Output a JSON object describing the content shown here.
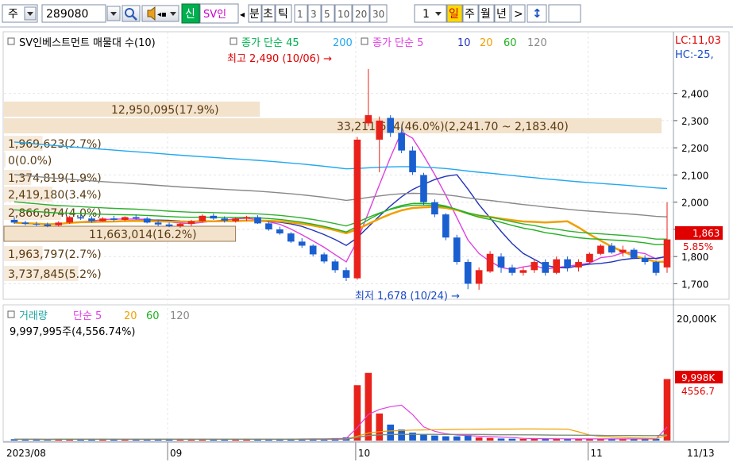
{
  "toolbar": {
    "market_label": "주",
    "code_value": "289080",
    "badge_new": "신",
    "name_value": "SV인",
    "period_btn_tick": "틱",
    "period_btn_min": "분",
    "period_btn_sec": "초",
    "intervals": [
      "1",
      "3",
      "5",
      "10",
      "20",
      "30"
    ],
    "interval_value": "1",
    "period_day": "일",
    "period_week": "주",
    "period_month": "월",
    "period_year": "년",
    "nav_prev": "◂",
    "nav_next": ">",
    "updown_icon": "↕",
    "colors": {
      "highlight": "#ffd800",
      "badge_green": "#00b050"
    }
  },
  "price_panel": {
    "legend": {
      "title": "SV인베스트먼트 매물대 수(10)",
      "ma_long_label": "종가 단순 45",
      "ma_long_200": "200",
      "ma_short_label": "종가 단순 5",
      "ma_short_10": "10",
      "ma_short_20": "20",
      "ma_short_60": "60",
      "ma_short_120": "120"
    },
    "corner_lc": "LC:11,03",
    "corner_hc": "HC:-25,",
    "last_price_tag": "1,863",
    "last_change_tag": "5.85%",
    "high_annot": "최고 2,490 (10/06) →",
    "low_annot": "최저 1,678 (10/24) →",
    "volume_profile": [
      {
        "label": "12,950,095(17.9%)",
        "pct": 17.9
      },
      {
        "label": "33,211,664(46.0%)(2,241.70 ~ 2,183.40)",
        "pct": 46.0
      },
      {
        "label": "1,969,623(2.7%)",
        "pct": 2.7
      },
      {
        "label": "0(0.0%)",
        "pct": 0.0
      },
      {
        "label": "1,374,819(1.9%)",
        "pct": 1.9
      },
      {
        "label": "2,419,180(3.4%)",
        "pct": 3.4
      },
      {
        "label": "2,866,874(4.0%)",
        "pct": 4.0
      },
      {
        "label": "11,663,014(16.2%)",
        "pct": 16.2
      },
      {
        "label": "1,963,797(2.7%)",
        "pct": 2.7
      },
      {
        "label": "3,737,845(5.2%)",
        "pct": 5.2
      }
    ]
  },
  "volume_panel": {
    "legend": {
      "title": "거래량",
      "ma_label": "단순 5",
      "ma_20": "20",
      "ma_60": "60",
      "ma_120": "120"
    },
    "summary": "9,997,995주(4,556.74%)",
    "last_volume_tag": "9,998K",
    "ma_value_tag": "4556.7",
    "y_top_label": "20,000K"
  },
  "x_axis_labels": [
    "2023/08",
    "09",
    "10",
    "11",
    "11/13"
  ],
  "chart_data": {
    "type": "candlestick",
    "price_axis": {
      "ticks": [
        2400,
        2300,
        2200,
        2100,
        2000,
        1900,
        1800,
        1700
      ],
      "tick_labels": [
        "2,400",
        "2,300",
        "2,200",
        "2,100",
        "2,000",
        "1,900",
        "1,800",
        "1,700"
      ],
      "range": [
        1640,
        2510
      ]
    },
    "volume_axis": {
      "ticks": [
        20000
      ],
      "tick_labels": [
        "20,000K"
      ],
      "range": [
        0,
        20000
      ]
    },
    "candles": [
      [
        1935,
        1945,
        1920,
        1925,
        220
      ],
      [
        1925,
        1932,
        1915,
        1920,
        200
      ],
      [
        1920,
        1928,
        1912,
        1918,
        190
      ],
      [
        1918,
        1925,
        1908,
        1912,
        180
      ],
      [
        1915,
        1930,
        1910,
        1925,
        230
      ],
      [
        1925,
        1950,
        1920,
        1945,
        260
      ],
      [
        1945,
        1955,
        1935,
        1940,
        210
      ],
      [
        1940,
        1948,
        1925,
        1930,
        190
      ],
      [
        1930,
        1945,
        1928,
        1940,
        200
      ],
      [
        1940,
        1950,
        1930,
        1935,
        180
      ],
      [
        1935,
        1948,
        1930,
        1945,
        190
      ],
      [
        1945,
        1955,
        1935,
        1940,
        200
      ],
      [
        1940,
        1946,
        1922,
        1925,
        210
      ],
      [
        1925,
        1932,
        1912,
        1918,
        230
      ],
      [
        1918,
        1925,
        1908,
        1912,
        200
      ],
      [
        1912,
        1924,
        1906,
        1920,
        190
      ],
      [
        1920,
        1935,
        1912,
        1930,
        240
      ],
      [
        1930,
        1955,
        1925,
        1950,
        260
      ],
      [
        1950,
        1958,
        1935,
        1940,
        210
      ],
      [
        1940,
        1948,
        1925,
        1932,
        200
      ],
      [
        1930,
        1944,
        1925,
        1940,
        190
      ],
      [
        1940,
        1950,
        1930,
        1945,
        180
      ],
      [
        1945,
        1952,
        1920,
        1922,
        230
      ],
      [
        1922,
        1930,
        1895,
        1900,
        260
      ],
      [
        1900,
        1910,
        1880,
        1885,
        250
      ],
      [
        1885,
        1890,
        1850,
        1855,
        270
      ],
      [
        1855,
        1868,
        1832,
        1840,
        260
      ],
      [
        1840,
        1845,
        1800,
        1808,
        300
      ],
      [
        1808,
        1815,
        1775,
        1782,
        320
      ],
      [
        1782,
        1790,
        1740,
        1750,
        400
      ],
      [
        1750,
        1760,
        1710,
        1722,
        520
      ],
      [
        1720,
        2240,
        1715,
        2230,
        9000
      ],
      [
        2290,
        2490,
        2280,
        2320,
        11000
      ],
      [
        2230,
        2315,
        2110,
        2300,
        4400
      ],
      [
        2310,
        2320,
        2240,
        2255,
        2600
      ],
      [
        2255,
        2275,
        2180,
        2190,
        1800
      ],
      [
        2190,
        2205,
        2100,
        2110,
        1300
      ],
      [
        2100,
        2108,
        1990,
        2000,
        1000
      ],
      [
        2000,
        2010,
        1945,
        1955,
        820
      ],
      [
        1955,
        1960,
        1860,
        1870,
        700
      ],
      [
        1870,
        1880,
        1770,
        1780,
        680
      ],
      [
        1780,
        1790,
        1680,
        1700,
        880
      ],
      [
        1700,
        1760,
        1678,
        1750,
        500
      ],
      [
        1745,
        1820,
        1740,
        1810,
        420
      ],
      [
        1800,
        1812,
        1740,
        1760,
        330
      ],
      [
        1760,
        1770,
        1730,
        1740,
        300
      ],
      [
        1740,
        1760,
        1730,
        1750,
        280
      ],
      [
        1750,
        1790,
        1740,
        1780,
        300
      ],
      [
        1780,
        1790,
        1730,
        1740,
        310
      ],
      [
        1740,
        1800,
        1735,
        1790,
        290
      ],
      [
        1790,
        1800,
        1745,
        1760,
        260
      ],
      [
        1760,
        1790,
        1745,
        1780,
        250
      ],
      [
        1780,
        1815,
        1775,
        1810,
        270
      ],
      [
        1810,
        1845,
        1805,
        1840,
        300
      ],
      [
        1840,
        1850,
        1810,
        1815,
        280
      ],
      [
        1815,
        1840,
        1800,
        1825,
        250
      ],
      [
        1825,
        1832,
        1790,
        1795,
        240
      ],
      [
        1795,
        1805,
        1770,
        1780,
        260
      ],
      [
        1780,
        1785,
        1730,
        1740,
        300
      ],
      [
        1760,
        2000,
        1740,
        1863,
        9998
      ]
    ],
    "ma_series": [
      {
        "period": 5,
        "color": "#e040e0"
      },
      {
        "period": 10,
        "color": "#2233bb"
      },
      {
        "period": 20,
        "color": "#f0a000"
      },
      {
        "period": 45,
        "color": "#20b020"
      },
      {
        "period": 60,
        "color": "#30b030"
      },
      {
        "period": 120,
        "color": "#888888"
      },
      {
        "period": 200,
        "color": "#20a8f0"
      }
    ],
    "volume_ma_series": [
      {
        "period": 5,
        "color": "#e040e0"
      },
      {
        "period": 20,
        "color": "#f0a000"
      },
      {
        "period": 60,
        "color": "#20b020"
      },
      {
        "period": 120,
        "color": "#888888"
      }
    ]
  }
}
